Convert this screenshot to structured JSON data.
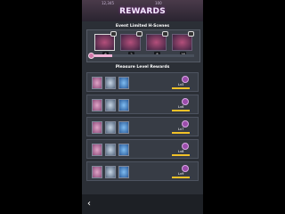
{
  "topbar": {
    "stat1": "12,345",
    "stat2": "100"
  },
  "title": "REWARDS",
  "event_section": {
    "title": "Event Limited H-Scenes",
    "counts": [
      "6",
      "2",
      "8",
      "16"
    ]
  },
  "progress": 0.18,
  "pleasure_section": {
    "title": "Pleasure Level Rewards",
    "rows": [
      {
        "level": "Lv5"
      },
      {
        "level": "Lv6"
      },
      {
        "level": "Lv7"
      },
      {
        "level": "Lv8"
      },
      {
        "level": "Lv9"
      }
    ]
  },
  "nav": {
    "back_icon": "chevron-left-icon"
  }
}
